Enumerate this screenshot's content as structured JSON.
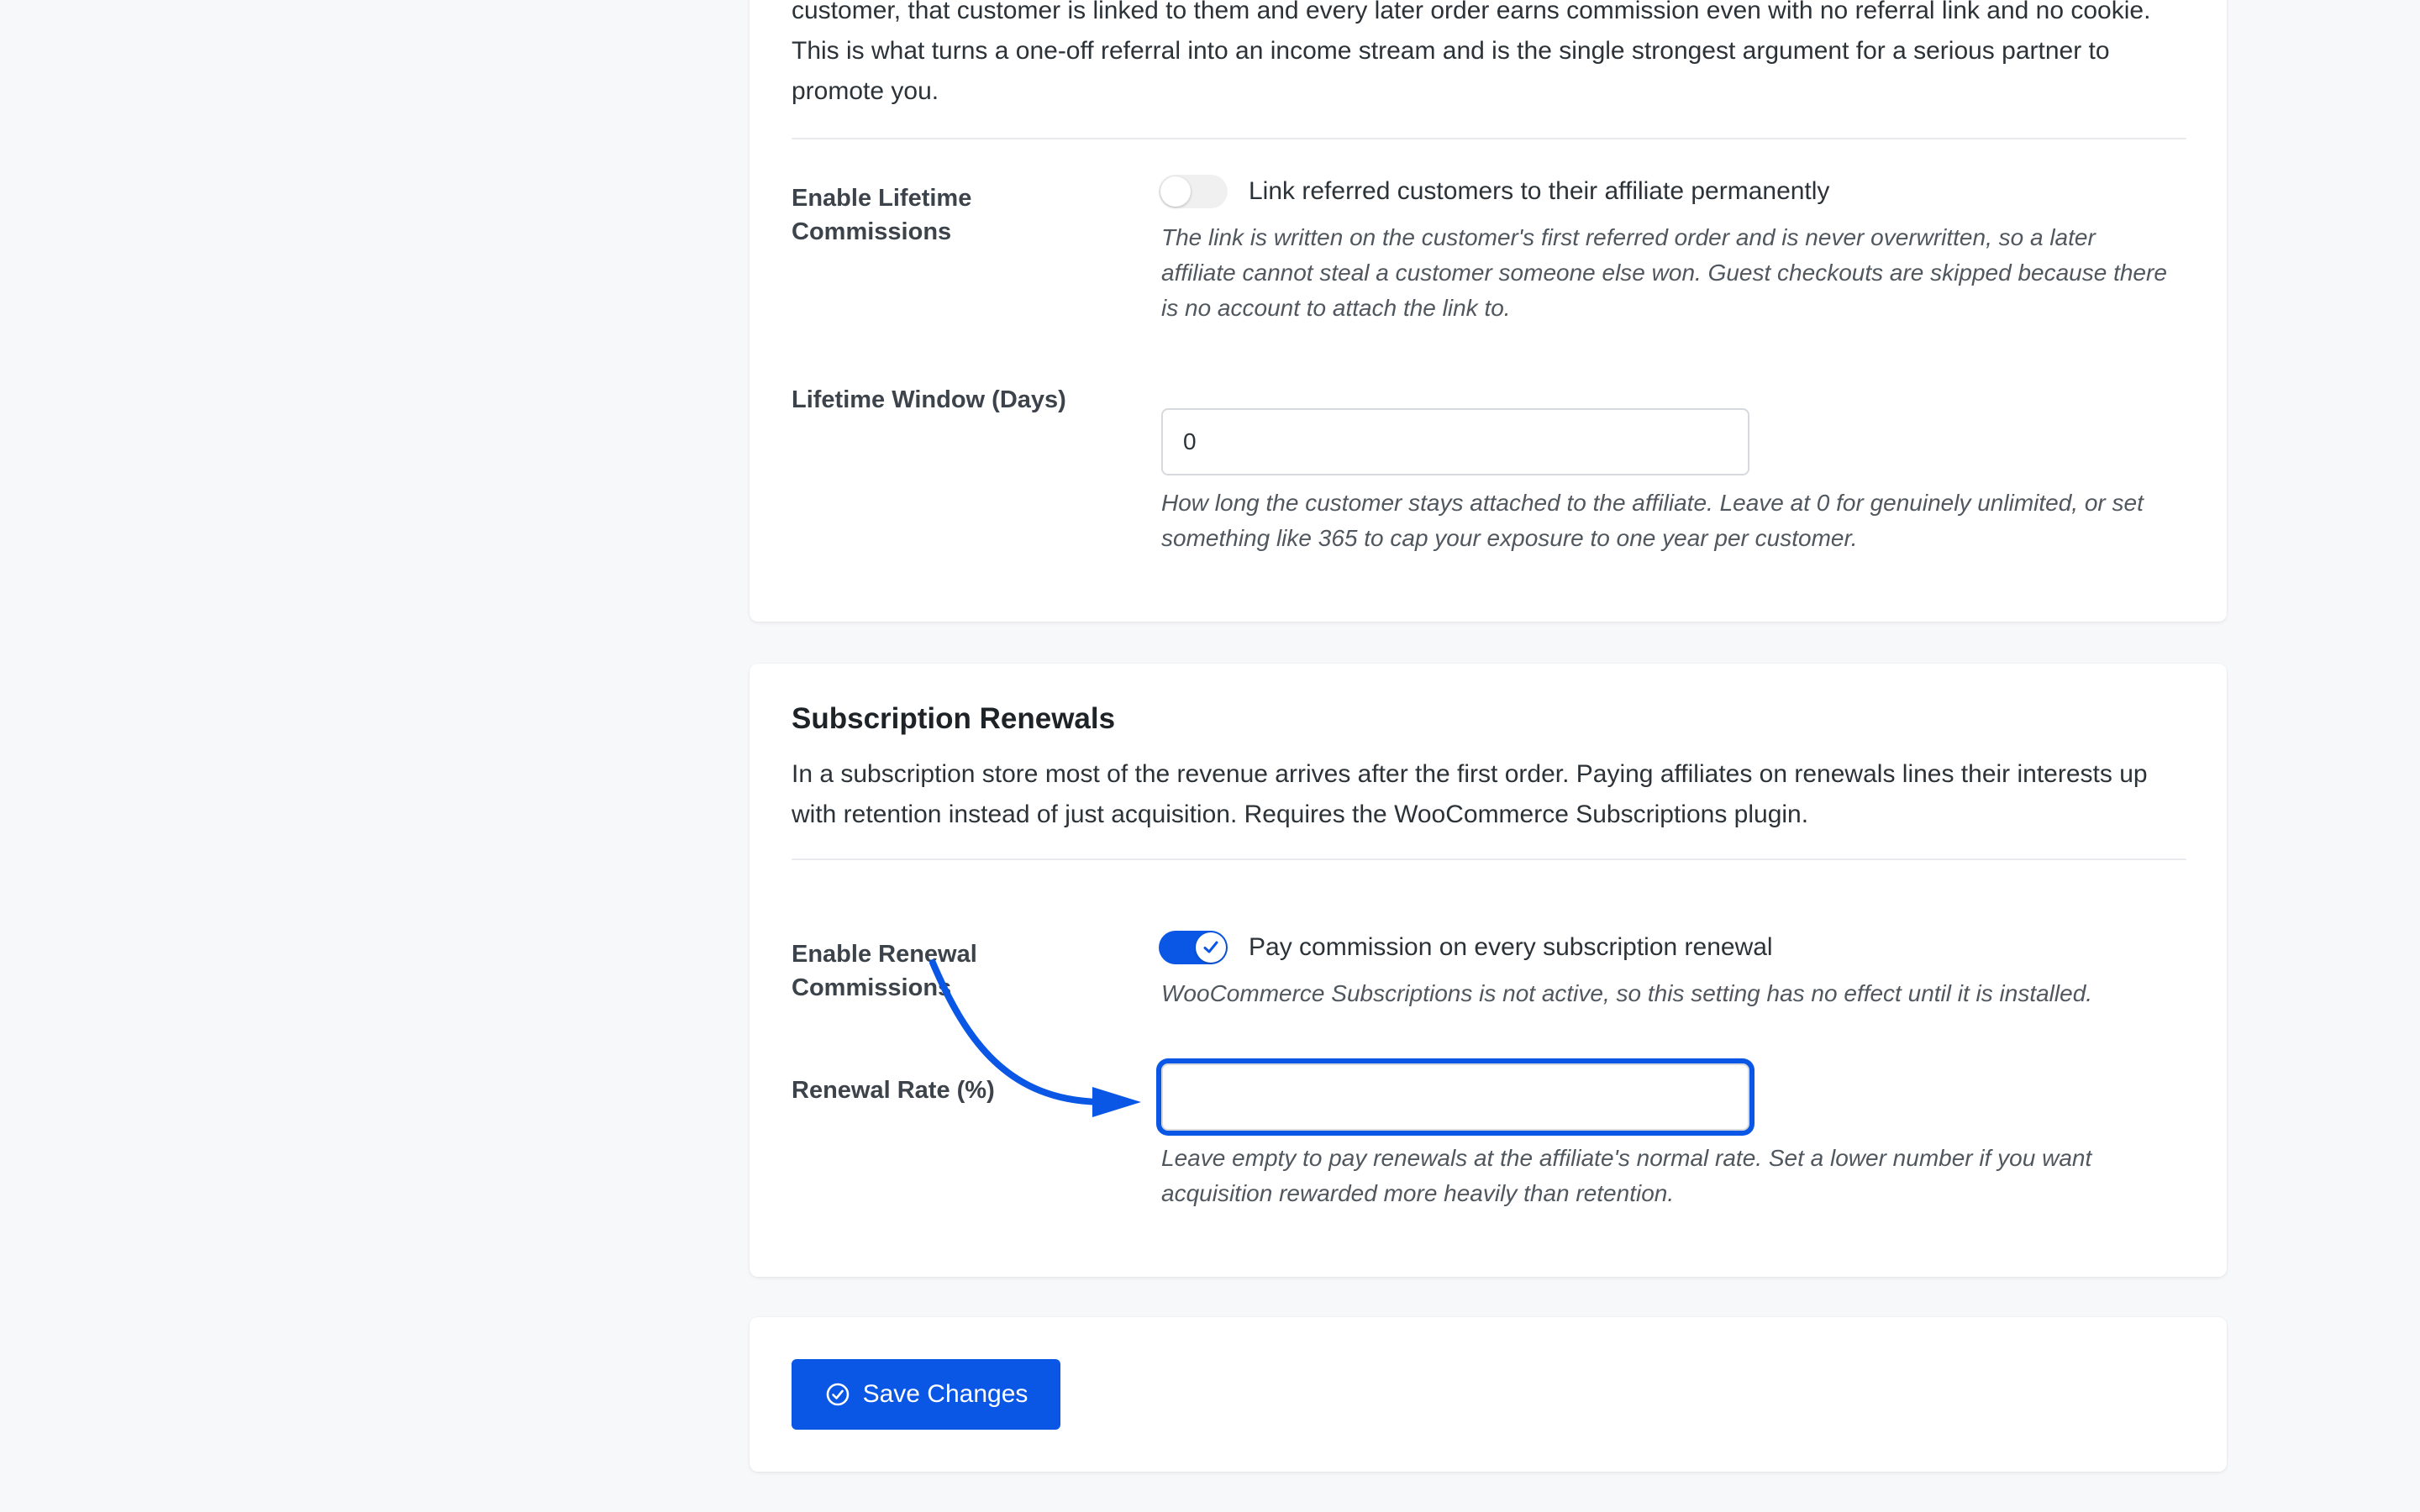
{
  "lifetime_section": {
    "intro": "customer, that customer is linked to them and every later order earns commission even with no referral link and no cookie. This is what turns a one-off referral into an income stream and is the single strongest argument for a serious partner to promote you.",
    "enable_label": "Enable Lifetime Commissions",
    "enable_toggle_state": "off",
    "enable_toggle_label": "Link referred customers to their affiliate permanently",
    "enable_help": "The link is written on the customer's first referred order and is never overwritten, so a later affiliate cannot steal a customer someone else won. Guest checkouts are skipped because there is no account to attach the link to.",
    "window_label": "Lifetime Window (Days)",
    "window_value": "0",
    "window_help": "How long the customer stays attached to the affiliate. Leave at 0 for genuinely unlimited, or set something like 365 to cap your exposure to one year per customer."
  },
  "renewals_section": {
    "title": "Subscription Renewals",
    "intro": "In a subscription store most of the revenue arrives after the first order. Paying affiliates on renewals lines their interests up with retention instead of just acquisition. Requires the WooCommerce Subscriptions plugin.",
    "enable_label": "Enable Renewal Commissions",
    "enable_toggle_state": "on",
    "enable_toggle_label": "Pay commission on every subscription renewal",
    "enable_help": "WooCommerce Subscriptions is not active, so this setting has no effect until it is installed.",
    "rate_label": "Renewal Rate (%)",
    "rate_value": "",
    "rate_help": "Leave empty to pay renewals at the affiliate's normal rate. Set a lower number if you want acquisition rewarded more heavily than retention."
  },
  "footer": {
    "save_label": "Save Changes"
  },
  "colors": {
    "accent": "#0a57e6",
    "background": "#f7f8fa",
    "card": "#ffffff"
  },
  "icons": {
    "save": "check-circle-icon",
    "toggle_on": "checkmark-icon",
    "annotation": "curved-arrow-icon"
  }
}
